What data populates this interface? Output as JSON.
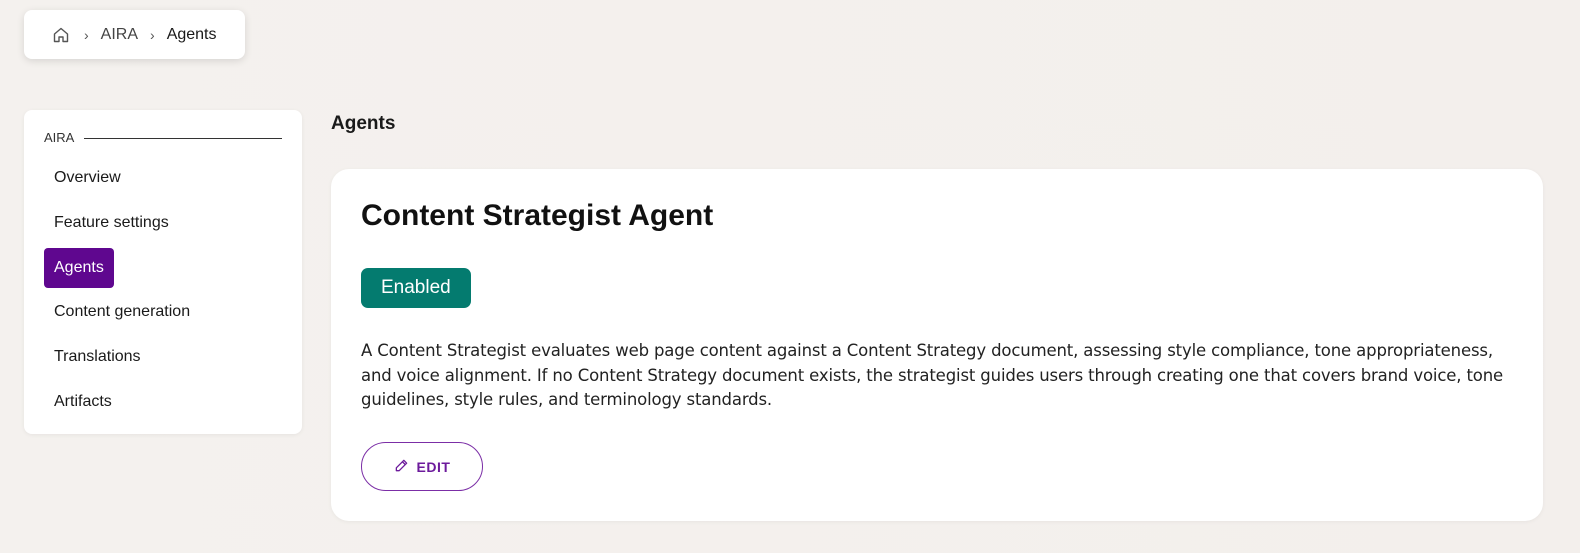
{
  "breadcrumb": {
    "home_icon": "home-icon",
    "items": [
      "AIRA",
      "Agents"
    ]
  },
  "sidebar": {
    "section_title": "AIRA",
    "items": [
      {
        "label": "Overview",
        "active": false
      },
      {
        "label": "Feature settings",
        "active": false
      },
      {
        "label": "Agents",
        "active": true
      },
      {
        "label": "Content generation",
        "active": false
      },
      {
        "label": "Translations",
        "active": false
      },
      {
        "label": "Artifacts",
        "active": false
      }
    ]
  },
  "main": {
    "page_title": "Agents",
    "agent": {
      "title": "Content Strategist Agent",
      "status": "Enabled",
      "description": "A Content Strategist evaluates web page content against a Content Strategy document, assessing style compliance, tone appropriateness, and voice alignment. If no Content Strategy document exists, the strategist guides users through creating one that covers brand voice, tone guidelines, style rules, and terminology standards.",
      "edit_label": "EDIT",
      "edit_icon": "pencil-icon"
    }
  },
  "colors": {
    "accent": "#5f078f",
    "status_enabled": "#047b6f",
    "edit_border": "#7b2ea6"
  }
}
